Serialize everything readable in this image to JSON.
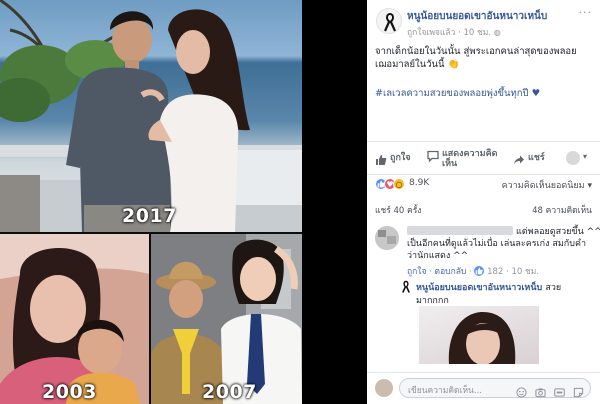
{
  "colors": {
    "fb_link": "#365899",
    "fb_blue": "#4267b2",
    "meta_gray": "#90949c",
    "text": "#1d2129",
    "like_blue": "#5890ff",
    "love_red": "#f25268",
    "wow_yellow": "#f7b928",
    "hashtag_heart": "#e0245e"
  },
  "photo": {
    "years": [
      "2017",
      "2003",
      "2007"
    ]
  },
  "post": {
    "author": "หนูน้อยบนยอดเขาอันหนาวเหน็บ",
    "audience": "ถูกใจเพจแล้ว",
    "time": "10 ชม.",
    "caption": "จากเด็กน้อยในวันนั้น สู่พระเอกคนล่าสุดของพลอย เฌอมาลย์ในวันนี้ 👏",
    "hashtag": "#เลเวลความสวยของพลอยพุ่งขึ้นทุกปี ♥"
  },
  "actions": {
    "like": "ถูกใจ",
    "comment": "แสดงความคิดเห็น",
    "share": "แชร์"
  },
  "reactions": {
    "count": "8.9K",
    "icons": [
      "like-reaction",
      "love-reaction",
      "wow-reaction"
    ],
    "sort_label": "ความคิดเห็นยอดนิยม ▾"
  },
  "stats": {
    "shares": "แชร์ 40 ครั้ง",
    "comments": "48 ความคิดเห็น"
  },
  "comment": {
    "text_line1": "แต่พลอยดูสวยขึ้น ^^",
    "text_line2": "เป็นอีกคนที่ดูแล้วไม่เบื่อ เล่นละครเก่ง สมกับคำว่านักแสดง ^^",
    "like_label": "ถูกใจ",
    "reply_label": "ตอบกลับ",
    "like_count": "182",
    "time": "10 ชม."
  },
  "reply": {
    "author": "หนูน้อยบนยอดเขาอันหนาวเหน็บ",
    "text_inline": "สวย",
    "text_line2": "มากกกก"
  },
  "composer": {
    "placeholder": "เขียนความคิดเห็น...",
    "tools": [
      "emoji-icon",
      "camera-icon",
      "gif-icon",
      "sticker-icon"
    ]
  }
}
